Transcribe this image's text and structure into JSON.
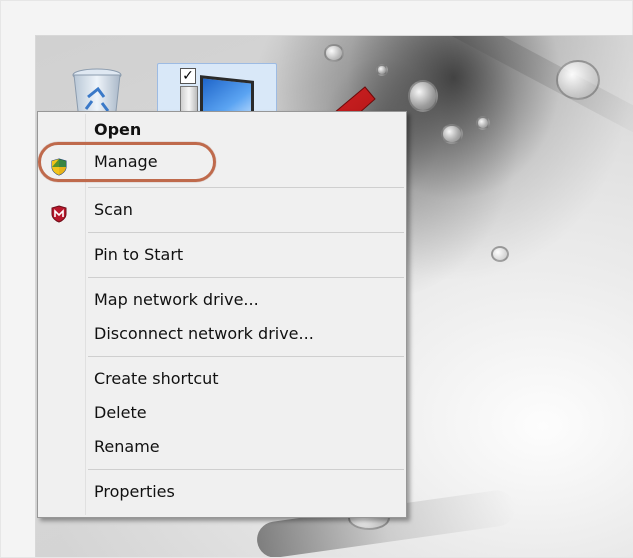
{
  "desktop": {
    "icons": [
      {
        "name": "recycle-bin"
      },
      {
        "name": "computer",
        "selected": true
      }
    ]
  },
  "context_menu": {
    "groups": [
      [
        {
          "label": "Open",
          "bold": true,
          "icon": null
        },
        {
          "label": "Manage",
          "icon": "uac-shield-icon",
          "highlighted": true
        }
      ],
      [
        {
          "label": "Scan",
          "icon": "mcafee-icon"
        }
      ],
      [
        {
          "label": "Pin to Start",
          "icon": null
        }
      ],
      [
        {
          "label": "Map network drive...",
          "icon": null
        },
        {
          "label": "Disconnect network drive...",
          "icon": null
        }
      ],
      [
        {
          "label": "Create shortcut",
          "icon": null
        },
        {
          "label": "Delete",
          "icon": null
        },
        {
          "label": "Rename",
          "icon": null
        }
      ],
      [
        {
          "label": "Properties",
          "icon": null
        }
      ]
    ]
  },
  "annotation": {
    "arrow_color": "#c0181a",
    "ellipse_color": "#bf6a4c"
  }
}
